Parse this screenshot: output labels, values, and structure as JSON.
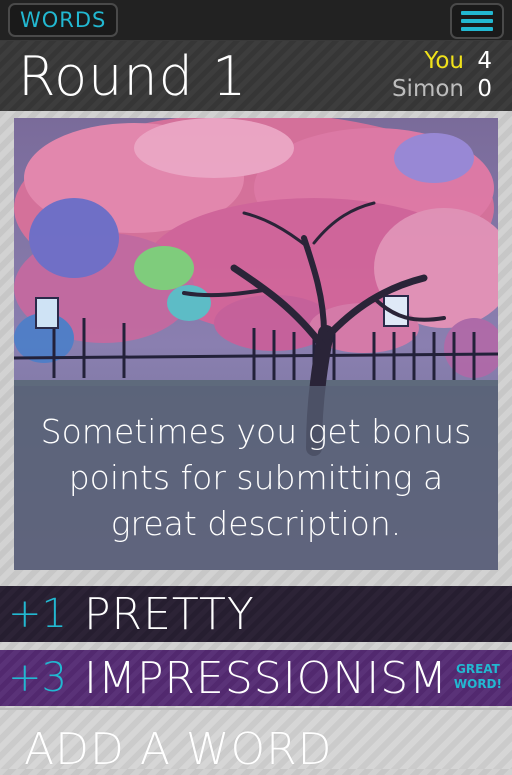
{
  "app": {
    "logo_text": "WORDS"
  },
  "header": {
    "round_title": "Round 1",
    "scores": [
      {
        "name": "You",
        "value": "4",
        "color": "#f0e21a"
      },
      {
        "name": "Simon",
        "value": "0",
        "color": "#bdbdbd"
      }
    ]
  },
  "card": {
    "image_icon": "painting-image",
    "caption": "Sometimes you get bonus points for submitting a great description."
  },
  "words": [
    {
      "points": "+1",
      "word": "PRETTY"
    },
    {
      "points": "+3",
      "word": "IMPRESSIONISM",
      "badge_line1": "GREAT",
      "badge_line2": "WORD!"
    }
  ],
  "add_word": {
    "label": "ADD A WORD"
  },
  "colors": {
    "accent": "#22b8d1",
    "you": "#f0e21a",
    "purple_row": "#5a3278",
    "dark_row": "#2c2336"
  }
}
